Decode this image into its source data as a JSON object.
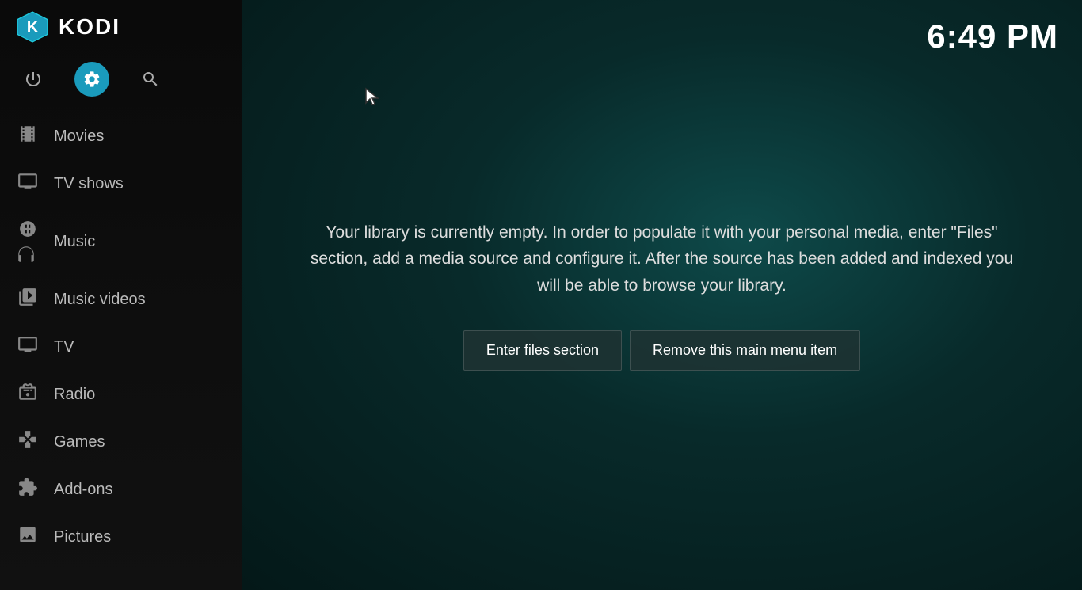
{
  "app": {
    "name": "KODI",
    "time": "6:49 PM"
  },
  "sidebar": {
    "icons": [
      {
        "name": "power",
        "label": "Power",
        "glyph": "⏻",
        "active": false
      },
      {
        "name": "settings",
        "label": "Settings",
        "glyph": "⚙",
        "active": true
      },
      {
        "name": "search",
        "label": "Search",
        "glyph": "🔍",
        "active": false
      }
    ],
    "nav_items": [
      {
        "id": "movies",
        "label": "Movies",
        "icon": "🎬"
      },
      {
        "id": "tv-shows",
        "label": "TV shows",
        "icon": "📺"
      },
      {
        "id": "music",
        "label": "Music",
        "icon": "🎧"
      },
      {
        "id": "music-videos",
        "label": "Music videos",
        "icon": "🎞"
      },
      {
        "id": "tv",
        "label": "TV",
        "icon": "📺"
      },
      {
        "id": "radio",
        "label": "Radio",
        "icon": "📻"
      },
      {
        "id": "games",
        "label": "Games",
        "icon": "🎮"
      },
      {
        "id": "add-ons",
        "label": "Add-ons",
        "icon": "📦"
      },
      {
        "id": "pictures",
        "label": "Pictures",
        "icon": "🖼"
      }
    ]
  },
  "main": {
    "library_message": "Your library is currently empty. In order to populate it with your personal media, enter \"Files\" section, add a media source and configure it. After the source has been added and indexed you will be able to browse your library.",
    "buttons": [
      {
        "id": "enter-files",
        "label": "Enter files section"
      },
      {
        "id": "remove-menu-item",
        "label": "Remove this main menu item"
      }
    ]
  }
}
